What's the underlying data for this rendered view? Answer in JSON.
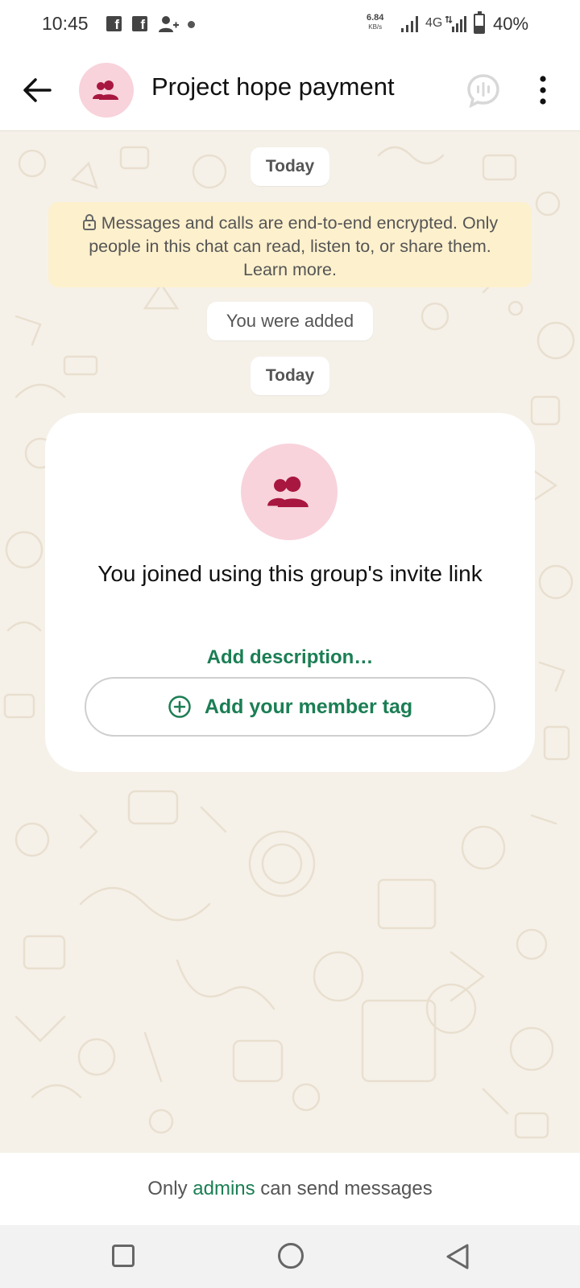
{
  "status_bar": {
    "time": "10:45",
    "notification_icons": [
      "facebook-icon",
      "facebook-icon",
      "person-add-icon",
      "dot-icon"
    ],
    "net_speed": "6.84",
    "net_speed_unit": "KB/s",
    "network_type": "4G",
    "battery_percent": "40%",
    "battery_level": 0.4
  },
  "app_bar": {
    "title": "Project hope payment",
    "avatar_icon": "group-icon",
    "back_icon": "back-arrow-icon",
    "call_icon": "voice-chat-icon",
    "menu_icon": "more-vertical-icon"
  },
  "chat": {
    "date_label_1": "Today",
    "encryption_notice": "Messages and calls are end-to-end encrypted. Only people in this chat can read, listen to, or share them. Learn more.",
    "system_message": "You were added",
    "date_label_2": "Today",
    "card": {
      "title": "You joined using this group's invite link",
      "add_description": "Add description…",
      "member_tag_button": "Add your member tag"
    }
  },
  "bottom_notice": {
    "prefix": "Only",
    "link": "admins",
    "suffix": "can send messages"
  },
  "nav_bar": {
    "icons": [
      "recent-apps-icon",
      "home-icon",
      "back-icon"
    ]
  },
  "colors": {
    "accent_green": "#1b7e54",
    "avatar_bg": "#f8d3dc",
    "avatar_icon": "#a8173f",
    "chat_bg": "#f5f1e9",
    "notice_bg": "#fdf0cd"
  }
}
